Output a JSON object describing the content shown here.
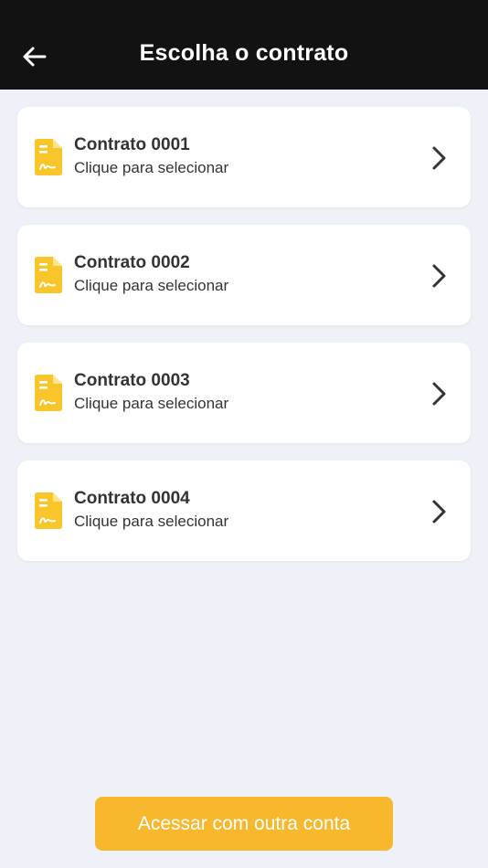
{
  "header": {
    "title": "Escolha o contrato",
    "back_icon": "arrow-left-icon"
  },
  "contracts": [
    {
      "title": "Contrato 0001",
      "subtitle": "Clique para selecionar"
    },
    {
      "title": "Contrato 0002",
      "subtitle": "Clique para selecionar"
    },
    {
      "title": "Contrato 0003",
      "subtitle": "Clique para selecionar"
    },
    {
      "title": "Contrato 0004",
      "subtitle": "Clique para selecionar"
    }
  ],
  "item_icon": "document-signature-icon",
  "item_chevron_icon": "chevron-right-icon",
  "footer": {
    "button_label": "Acessar com outra conta"
  },
  "colors": {
    "header_bg": "#121212",
    "page_bg": "#eef2f8",
    "accent_yellow": "#f8c62a",
    "button_bg": "#f8b82e",
    "text_dark": "#333333"
  }
}
